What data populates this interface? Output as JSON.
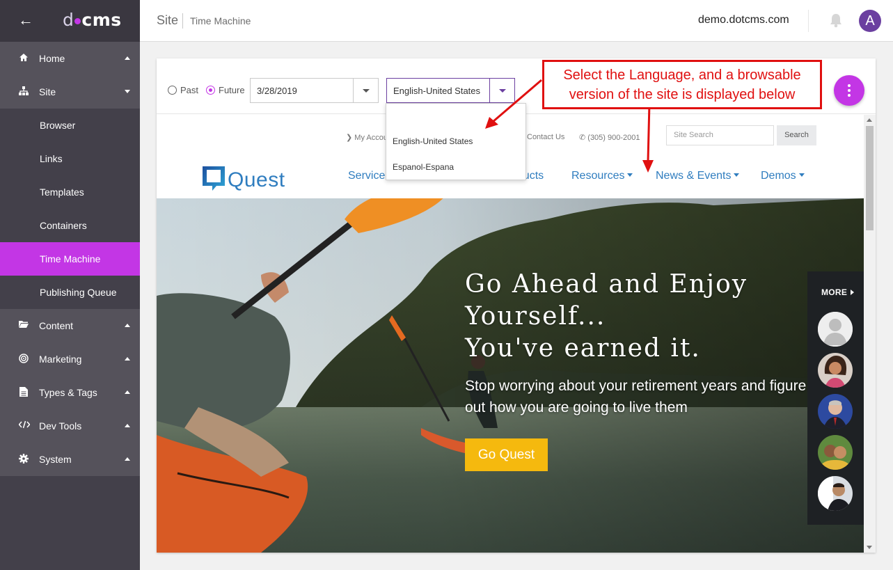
{
  "sidebar": {
    "logo_prefix": "d",
    "logo_suffix": "cms",
    "items": [
      {
        "label": "Home"
      },
      {
        "label": "Site"
      },
      {
        "label": "Browser"
      },
      {
        "label": "Links"
      },
      {
        "label": "Templates"
      },
      {
        "label": "Containers"
      },
      {
        "label": "Time Machine"
      },
      {
        "label": "Publishing Queue"
      },
      {
        "label": "Content"
      },
      {
        "label": "Marketing"
      },
      {
        "label": "Types & Tags"
      },
      {
        "label": "Dev Tools"
      },
      {
        "label": "System"
      }
    ]
  },
  "header": {
    "section": "Site",
    "page": "Time Machine",
    "site_name": "demo.dotcms.com",
    "avatar_letter": "A"
  },
  "toolbar": {
    "past_label": "Past",
    "future_label": "Future",
    "date_value": "3/28/2019",
    "language_value": "English-United States",
    "language_options": [
      "English-United States",
      "Espanol-Espana"
    ]
  },
  "annotation": {
    "line1": "Select the Language, and a browsable",
    "line2": "version of the site is displayed below"
  },
  "preview": {
    "util_account": "My Accou",
    "util_contact": "Contact Us",
    "util_phone": "(305) 900-2001",
    "search_placeholder": "Site Search",
    "search_button": "Search",
    "logo_text": "Quest",
    "nav": [
      "Services",
      "Products",
      "Resources",
      "News & Events",
      "Demos"
    ],
    "hero_title_1": "Go Ahead and Enjoy",
    "hero_title_2": "Yourself...",
    "hero_title_3": "You've earned it.",
    "hero_sub_1": "Stop worrying about your retirement years and figure",
    "hero_sub_2": "out how you are going to live them",
    "hero_button": "Go Quest",
    "more_label": "MORE"
  },
  "colors": {
    "accent": "#c336e5",
    "primary": "#6b3fa0",
    "sidebar": "#43404a",
    "annotation": "#e01010",
    "quest_blue": "#2f7dbf",
    "cta": "#f5b90e"
  }
}
